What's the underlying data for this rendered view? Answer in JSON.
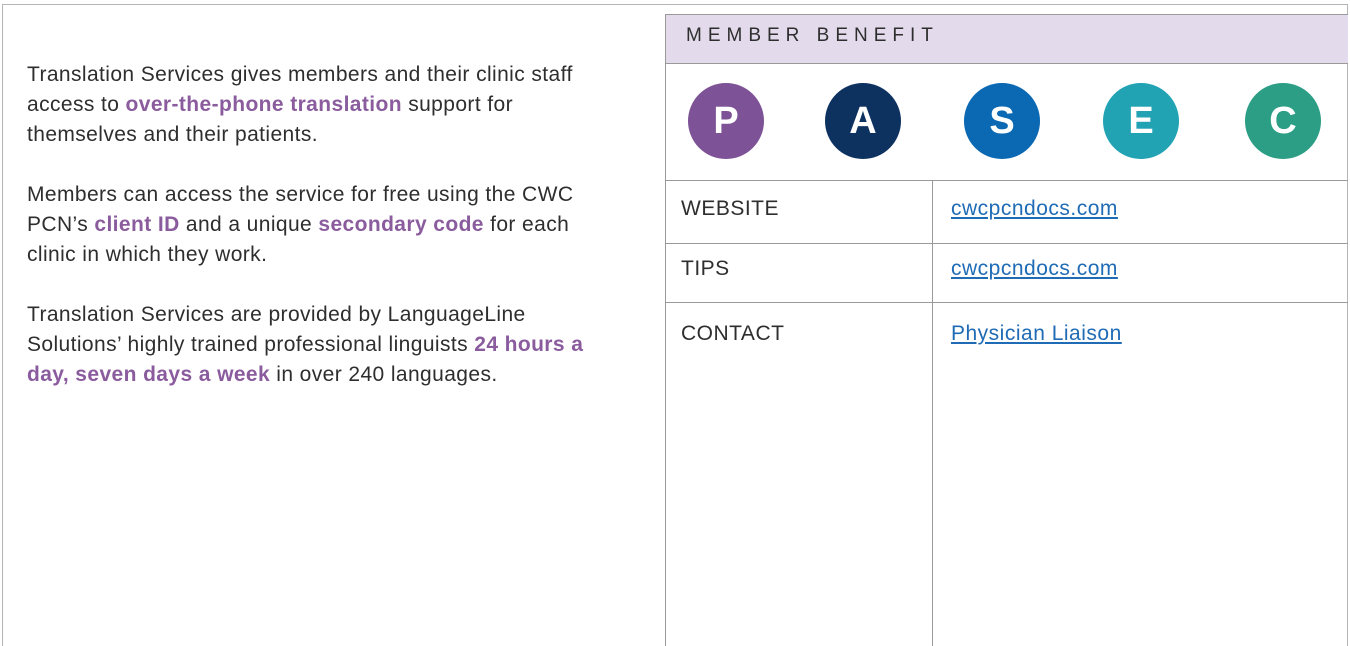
{
  "intro": {
    "p1_a": "Translation Services gives members and their clinic staff access to ",
    "p1_hl": "over-the-phone translation",
    "p1_b": " support for themselves and their patients.",
    "p2_a": "Members can access the service for free using the CWC PCN’s ",
    "p2_hl1": "client ID",
    "p2_b": " and a unique ",
    "p2_hl2": "secondary code",
    "p2_c": " for each clinic in which they work.",
    "p3_a": "Translation Services are provided by LanguageLine Solutions’ highly trained professional linguists ",
    "p3_hl": "24 hours a day, seven days a week",
    "p3_b": " in over 240 languages."
  },
  "panel": {
    "header": "MEMBER BENEFIT",
    "circles": [
      {
        "letter": "P",
        "color": "#7d5296"
      },
      {
        "letter": "A",
        "color": "#0e3260"
      },
      {
        "letter": "S",
        "color": "#0b68b2"
      },
      {
        "letter": "E",
        "color": "#22a3b4"
      },
      {
        "letter": "C",
        "color": "#2c9e86"
      }
    ],
    "rows": [
      {
        "label": "WEBSITE",
        "link": "cwcpcndocs.com"
      },
      {
        "label": "TIPS",
        "link": "cwcpcndocs.com"
      },
      {
        "label": "CONTACT",
        "link": "Physician Liaison"
      }
    ]
  },
  "colors": {
    "highlight": "#8a5c9e",
    "link": "#1f6bb5",
    "header_bg": "#e3dbeb"
  }
}
